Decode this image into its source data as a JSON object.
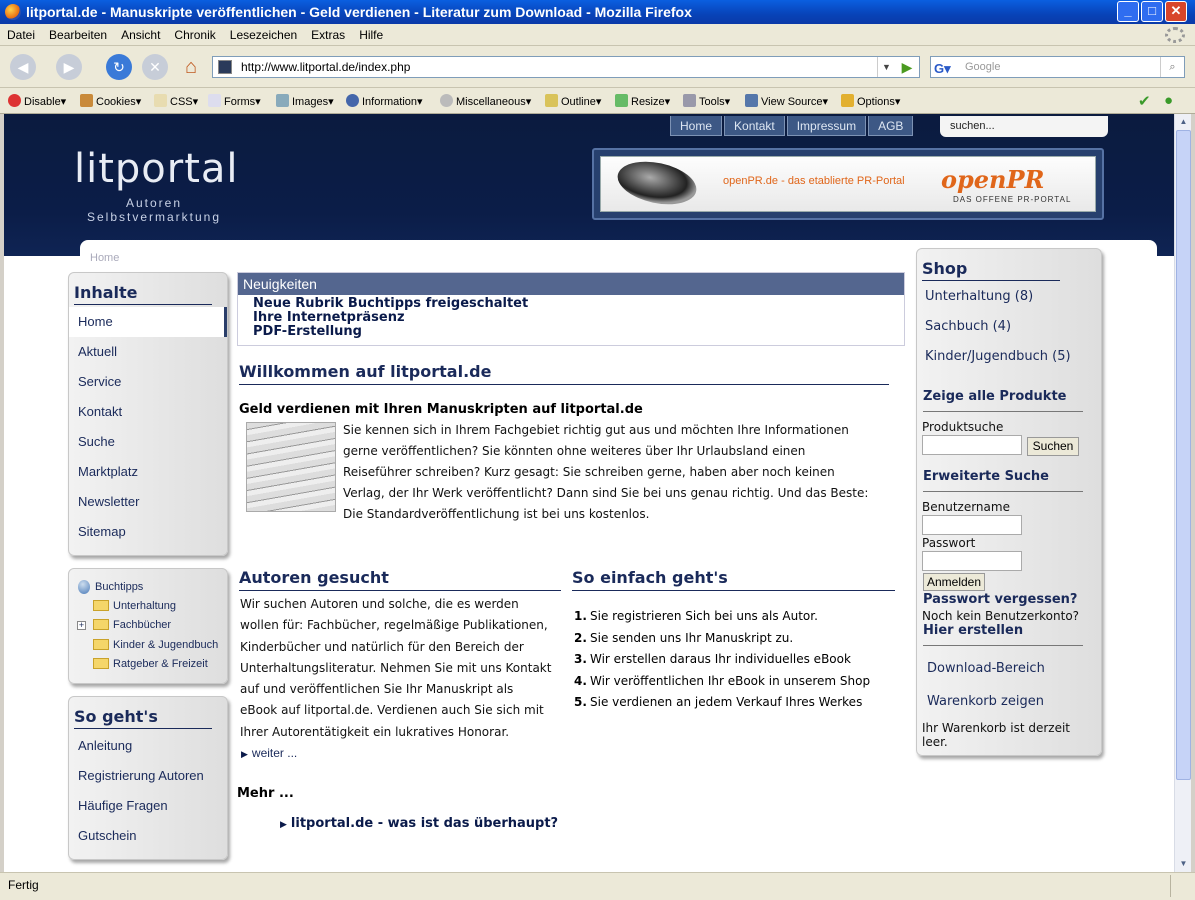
{
  "window": {
    "title": "litportal.de - Manuskripte veröffentlichen - Geld verdienen - Literatur zum Download - Mozilla Firefox"
  },
  "menu": [
    "Datei",
    "Bearbeiten",
    "Ansicht",
    "Chronik",
    "Lesezeichen",
    "Extras",
    "Hilfe"
  ],
  "address": {
    "url": "http://www.litportal.de/index.php",
    "search_placeholder": "Google"
  },
  "devbar": [
    "Disable▾",
    "Cookies▾",
    "CSS▾",
    "Forms▾",
    "Images▾",
    "Information▾",
    "Miscellaneous▾",
    "Outline▾",
    "Resize▾",
    "Tools▾",
    "View Source▾",
    "Options▾"
  ],
  "status": "Fertig",
  "page": {
    "topnav": [
      "Home",
      "Kontakt",
      "Impressum",
      "AGB"
    ],
    "search_placeholder": "suchen...",
    "logo": "litportal",
    "tagline": [
      "Autoren",
      "Selbstvermarktung"
    ],
    "ad": {
      "text": "openPR.de - das etablierte PR-Portal",
      "brand": "openPR",
      "sub": "DAS OFFENE PR-PORTAL"
    },
    "breadcrumb": "Home",
    "inhalte": {
      "title": "Inhalte",
      "items": [
        "Home",
        "Aktuell",
        "Service",
        "Kontakt",
        "Suche",
        "Marktplatz",
        "Newsletter",
        "Sitemap"
      ]
    },
    "buchtipps": {
      "title": "Buchtipps",
      "items": [
        "Unterhaltung",
        "Fachbücher",
        "Kinder & Jugendbuch",
        "Ratgeber & Freizeit"
      ]
    },
    "sogehts": {
      "title": "So geht's",
      "items": [
        "Anleitung",
        "Registrierung Autoren",
        "Häufige Fragen",
        "Gutschein"
      ]
    },
    "news": {
      "title": "Neuigkeiten",
      "items": [
        "Neue Rubrik Buchtipps freigeschaltet",
        "Ihre Internetpräsenz",
        "PDF-Erstellung"
      ]
    },
    "welcome": {
      "title": "Willkommen auf litportal.de",
      "subtitle": "Geld verdienen mit Ihren Manuskripten auf litportal.de",
      "lines": [
        "Sie kennen sich in Ihrem Fachgebiet richtig gut aus und möchten Ihre Informationen",
        "gerne veröffentlichen? Sie könnten ohne weiteres über Ihr Urlaubsland einen",
        "Reiseführer schreiben?  Kurz gesagt: Sie schreiben gerne, haben aber noch keinen",
        "Verlag, der Ihr Werk veröffentlicht? Dann sind Sie bei uns genau richtig. Und das Beste:",
        "Die Standardveröffentlichung ist bei uns kostenlos."
      ]
    },
    "authors": {
      "title": "Autoren gesucht",
      "lines": [
        "Wir suchen Autoren und solche, die es werden",
        "wollen für: Fachbücher, regelmäßige Publikationen,",
        "Kinderbücher und natürlich für den Bereich der",
        "Unterhaltungsliteratur. Nehmen Sie mit uns Kontakt",
        "auf und veröffentlichen Sie Ihr Manuskript als",
        "eBook auf litportal.de. Verdienen auch Sie sich mit",
        "Ihrer Autorentätigkeit ein lukratives Honorar."
      ],
      "more": "weiter ..."
    },
    "easy": {
      "title": "So einfach geht's",
      "steps": [
        "Sie registrieren Sich bei uns als Autor.",
        "Sie senden uns Ihr Manuskript zu.",
        "Wir erstellen daraus Ihr individuelles eBook",
        "Wir veröffentlichen Ihr eBook in unserem Shop",
        "Sie verdienen an jedem Verkauf Ihres Werkes"
      ]
    },
    "mehr": "Mehr ...",
    "whatis": "litportal.de - was ist das überhaupt?",
    "shop": {
      "title": "Shop",
      "cats": [
        "Unterhaltung (8)",
        "Sachbuch (4)",
        "Kinder/Jugendbuch (5)"
      ],
      "all": "Zeige alle Produkte",
      "search_label": "Produktsuche",
      "search_btn": "Suchen",
      "adv": "Erweiterte Suche",
      "user_label": "Benutzername",
      "pass_label": "Passwort",
      "login_btn": "Anmelden",
      "forgot": "Passwort vergessen?",
      "noacc": "Noch kein Benutzerkonto?",
      "create": "Hier erstellen",
      "download": "Download-Bereich",
      "cart": "Warenkorb zeigen",
      "cart_empty": "Ihr Warenkorb ist derzeit leer."
    }
  }
}
